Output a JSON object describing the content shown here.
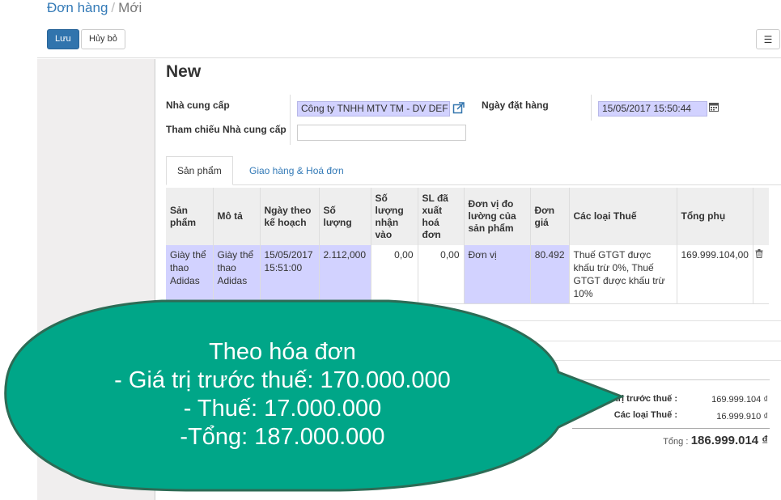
{
  "breadcrumb": {
    "parent": "Đơn hàng",
    "separator": "/",
    "current": "Mới"
  },
  "buttons": {
    "save": "Lưu",
    "discard": "Hủy bỏ"
  },
  "view_switch_icon": "list-icon",
  "form": {
    "title": "New",
    "vendor_label": "Nhà cung cấp",
    "vendor_value": "Công ty TNHH MTV TM - DV DEF",
    "vendor_ref_label": "Tham chiếu Nhà cung cấp",
    "vendor_ref_value": "",
    "order_date_label": "Ngày đặt hàng",
    "order_date_value": "15/05/2017 15:50:44"
  },
  "tabs": [
    {
      "label": "Sản phẩm",
      "active": true
    },
    {
      "label": "Giao hàng & Hoá đơn",
      "active": false
    }
  ],
  "lines": {
    "headers": [
      "Sản phẩm",
      "Mô tả",
      "Ngày theo kế hoạch",
      "Số lượng",
      "Số lượng nhận vào",
      "SL đã xuất hoá đơn",
      "Đơn vị đo lường của sản phẩm",
      "Đơn giá",
      "Các loại Thuế",
      "Tổng phụ"
    ],
    "rows": [
      {
        "product": "Giày thể thao Adidas",
        "description": "Giày thể thao Adidas",
        "planned_date": "15/05/2017 15:51:00",
        "quantity": "2.112,000",
        "qty_received": "0,00",
        "qty_invoiced": "0,00",
        "uom": "Đơn vị",
        "unit_price": "80.492",
        "taxes": "Thuế GTGT được khấu trừ 0%, Thuế GTGT được khấu trừ 10%",
        "subtotal": "169.999.104,00"
      }
    ]
  },
  "totals": {
    "untaxed_label": "Giá trị trước thuế :",
    "untaxed_value": "169.999.104 ₫",
    "taxes_label": "Các loại Thuế :",
    "taxes_value": "16.999.910 ₫",
    "total_label": "Tổng :",
    "total_value": "186.999.014 ₫"
  },
  "callout": {
    "lines": [
      "Theo hóa đơn",
      "- Giá trị trước thuế: 170.000.000",
      "- Thuế: 17.000.000",
      "-Tổng: 187.000.000"
    ]
  },
  "colors": {
    "callout_fill": "#00a688",
    "callout_stroke": "#2d6b55",
    "primary_button": "#3174ad",
    "required_field": "#d2d2ff"
  }
}
